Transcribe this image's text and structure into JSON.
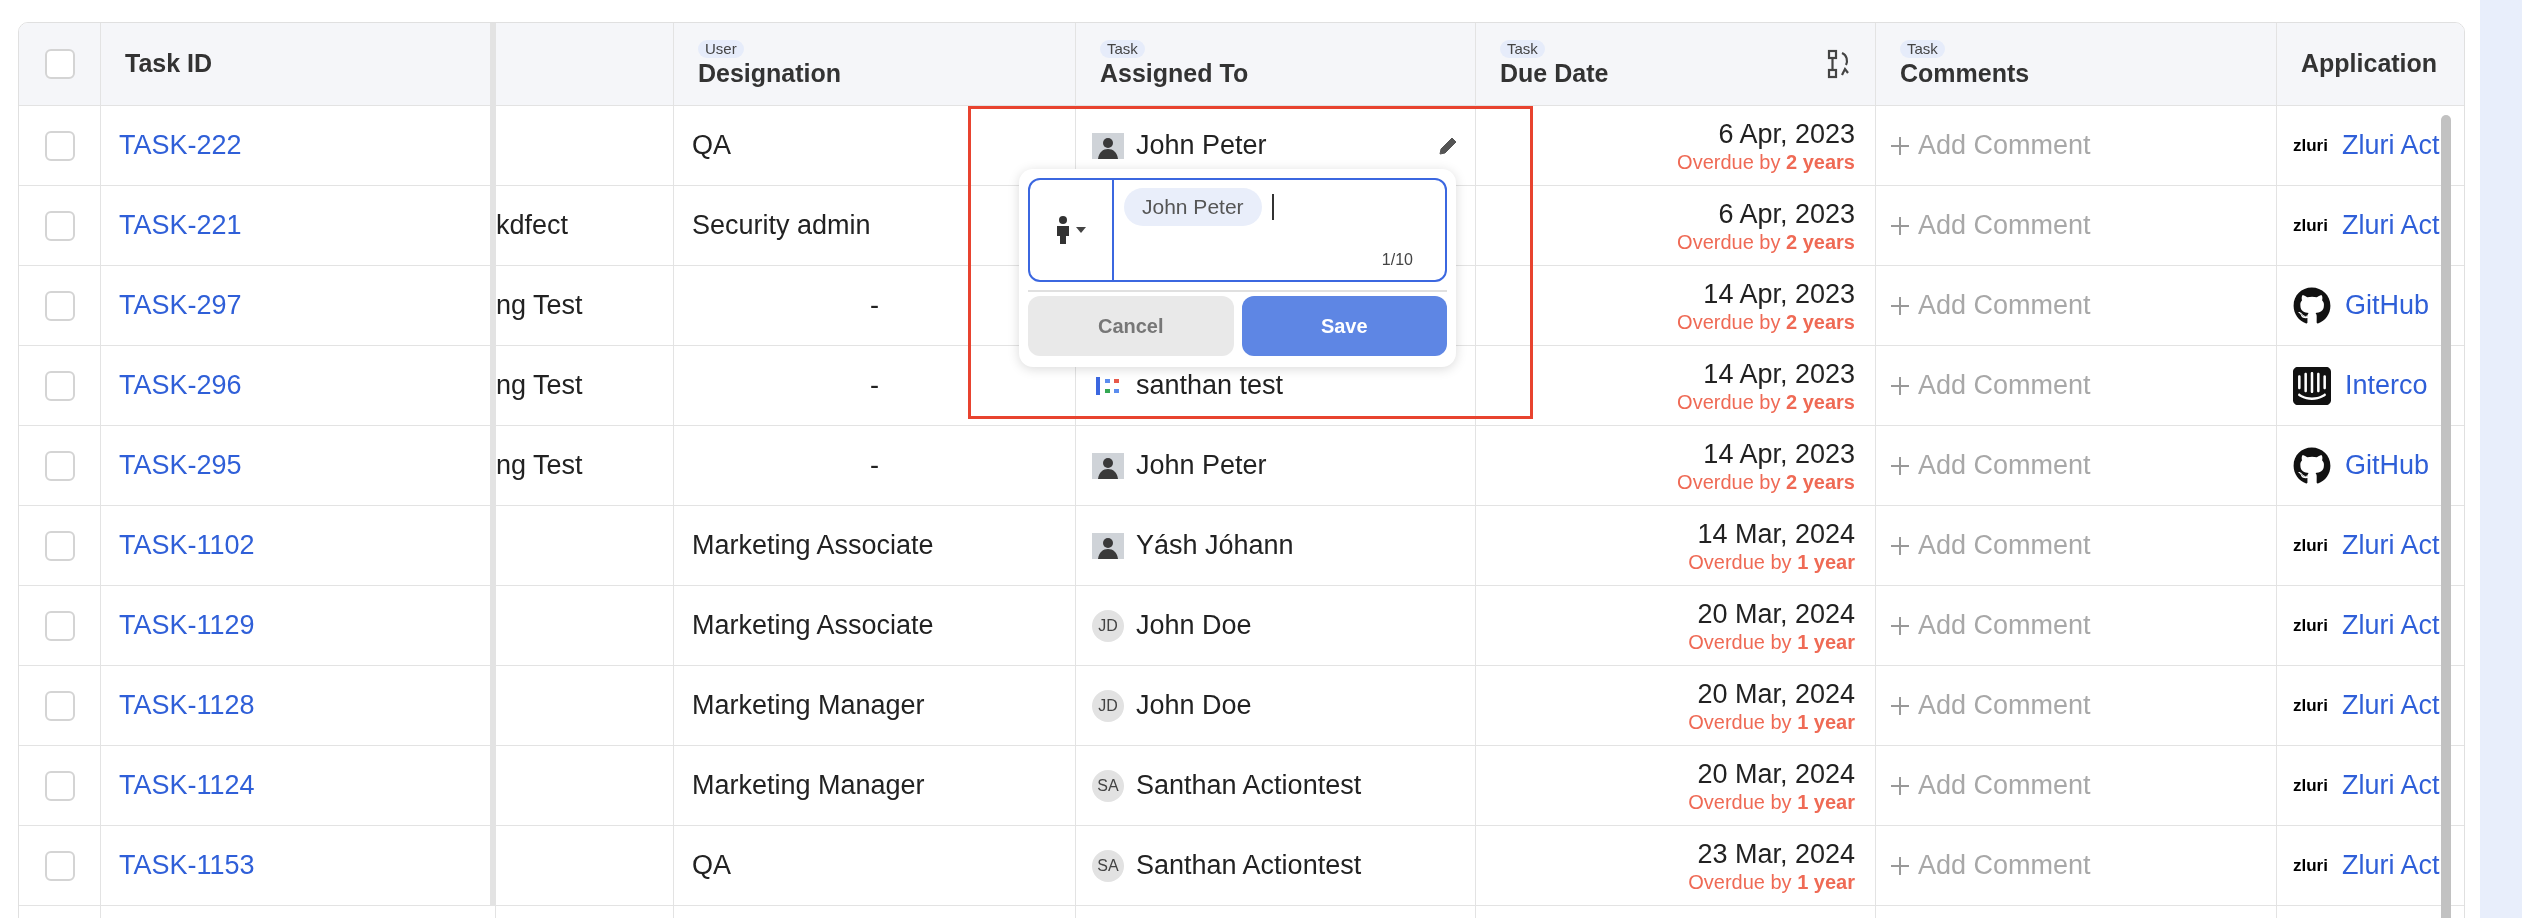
{
  "table": {
    "select_all_checked": false,
    "header": {
      "task_id": {
        "label": "Task ID"
      },
      "designation": {
        "tag": "User",
        "label": "Designation"
      },
      "assigned_to": {
        "tag": "Task",
        "label": "Assigned To"
      },
      "due_date": {
        "tag": "Task",
        "label": "Due Date"
      },
      "comments": {
        "tag": "Task",
        "label": "Comments"
      },
      "application": {
        "label": "Application"
      }
    },
    "rows": [
      {
        "checked": false,
        "editing": true,
        "task_id": "TASK-222",
        "designation": {
          "kind": "value",
          "text": "QA"
        },
        "assignee": {
          "name": "John Peter",
          "kind": "photo"
        },
        "due": "6 Apr, 2023",
        "overdue_prefix": "Overdue by",
        "overdue": "2 years",
        "comment": "Add Comment",
        "app": {
          "kind": "zluri",
          "logo_text": "zluri",
          "name": "Zluri Act"
        }
      },
      {
        "checked": false,
        "editing": false,
        "task_id": "TASK-221",
        "column_2": "kdfect",
        "designation": {
          "kind": "value",
          "text": "Security admin"
        },
        "due": "6 Apr, 2023",
        "overdue_prefix": "Overdue by",
        "overdue": "2 years",
        "comment": "Add Comment",
        "app": {
          "kind": "zluri",
          "logo_text": "zluri",
          "name": "Zluri Act"
        }
      },
      {
        "checked": false,
        "editing": false,
        "task_id": "TASK-297",
        "column_2": "ng Test",
        "designation": {
          "kind": "empty",
          "text": "-"
        },
        "due": "14 Apr, 2023",
        "overdue_prefix": "Overdue by",
        "overdue": "2 years",
        "comment": "Add Comment",
        "app": {
          "kind": "github",
          "name": "GitHub"
        }
      },
      {
        "checked": false,
        "editing": false,
        "task_id": "TASK-296",
        "column_2": "ng Test",
        "designation": {
          "kind": "empty",
          "text": "-"
        },
        "assignee": {
          "name": "santhan test",
          "kind": "image"
        },
        "due": "14 Apr, 2023",
        "overdue_prefix": "Overdue by",
        "overdue": "2 years",
        "comment": "Add Comment",
        "app": {
          "kind": "intercom",
          "name": "Interco"
        }
      },
      {
        "checked": false,
        "editing": false,
        "task_id": "TASK-295",
        "column_2": "ng Test",
        "designation": {
          "kind": "empty",
          "text": "-"
        },
        "assignee": {
          "name": "John Peter",
          "kind": "photo"
        },
        "due": "14 Apr, 2023",
        "overdue_prefix": "Overdue by",
        "overdue": "2 years",
        "comment": "Add Comment",
        "app": {
          "kind": "github",
          "name": "GitHub"
        }
      },
      {
        "checked": false,
        "editing": false,
        "task_id": "TASK-1102",
        "designation": {
          "kind": "value",
          "text": "Marketing Associate"
        },
        "assignee": {
          "name": "Yásh Jóhann",
          "kind": "photo"
        },
        "due": "14 Mar, 2024",
        "overdue_prefix": "Overdue by",
        "overdue": "1 year",
        "comment": "Add Comment",
        "app": {
          "kind": "zluri",
          "logo_text": "zluri",
          "name": "Zluri Act"
        }
      },
      {
        "checked": false,
        "editing": false,
        "task_id": "TASK-1129",
        "designation": {
          "kind": "value",
          "text": "Marketing Associate"
        },
        "assignee": {
          "name": "John Doe",
          "kind": "initials",
          "initials": "JD"
        },
        "due": "20 Mar, 2024",
        "overdue_prefix": "Overdue by",
        "overdue": "1 year",
        "comment": "Add Comment",
        "app": {
          "kind": "zluri",
          "logo_text": "zluri",
          "name": "Zluri Act"
        }
      },
      {
        "checked": false,
        "editing": false,
        "task_id": "TASK-1128",
        "designation": {
          "kind": "value",
          "text": "Marketing Manager"
        },
        "assignee": {
          "name": "John Doe",
          "kind": "initials",
          "initials": "JD"
        },
        "due": "20 Mar, 2024",
        "overdue_prefix": "Overdue by",
        "overdue": "1 year",
        "comment": "Add Comment",
        "app": {
          "kind": "zluri",
          "logo_text": "zluri",
          "name": "Zluri Act"
        }
      },
      {
        "checked": false,
        "editing": false,
        "task_id": "TASK-1124",
        "designation": {
          "kind": "value",
          "text": "Marketing Manager"
        },
        "assignee": {
          "name": "Santhan Actiontest",
          "kind": "initials",
          "initials": "SA"
        },
        "due": "20 Mar, 2024",
        "overdue_prefix": "Overdue by",
        "overdue": "1 year",
        "comment": "Add Comment",
        "app": {
          "kind": "zluri",
          "logo_text": "zluri",
          "name": "Zluri Act"
        }
      },
      {
        "checked": false,
        "editing": false,
        "task_id": "TASK-1153",
        "designation": {
          "kind": "value",
          "text": "QA"
        },
        "assignee": {
          "name": "Santhan Actiontest",
          "kind": "initials",
          "initials": "SA"
        },
        "due": "23 Mar, 2024",
        "overdue_prefix": "Overdue by",
        "overdue": "1 year",
        "comment": "Add Comment",
        "app": {
          "kind": "zluri",
          "logo_text": "zluri",
          "name": "Zluri Act"
        }
      }
    ]
  },
  "assignee_editor": {
    "chip": "John Peter",
    "counter": "1/10",
    "cancel": "Cancel",
    "save": "Save"
  }
}
